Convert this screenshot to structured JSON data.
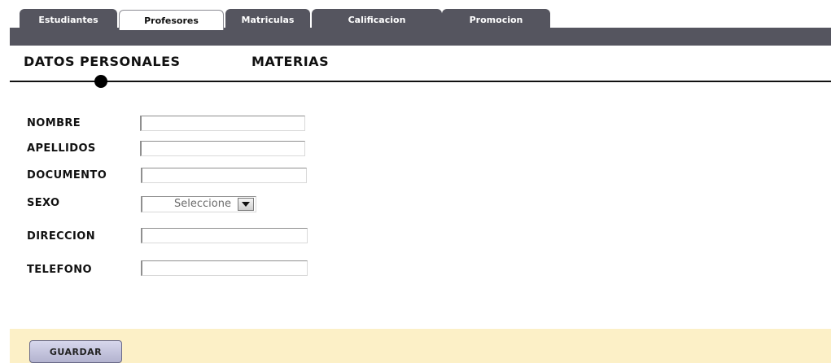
{
  "tabs": [
    {
      "label": "Estudiantes",
      "active": false
    },
    {
      "label": "Profesores",
      "active": true
    },
    {
      "label": "Matriculas",
      "active": false
    },
    {
      "label": "Calificacion",
      "active": false
    },
    {
      "label": "Promocion",
      "active": false
    }
  ],
  "subtabs": {
    "personal": "DATOS PERSONALES",
    "materias": "MATERIAS",
    "selected": "DATOS PERSONALES"
  },
  "form": {
    "nombre": {
      "label": "NOMBRE",
      "value": ""
    },
    "apellidos": {
      "label": "APELLIDOS",
      "value": ""
    },
    "documento": {
      "label": "DOCUMENTO",
      "value": ""
    },
    "sexo": {
      "label": "SEXO",
      "selected": "Seleccione"
    },
    "direccion": {
      "label": "DIRECCION",
      "value": ""
    },
    "telefono": {
      "label": "TELEFONO",
      "value": ""
    }
  },
  "footer": {
    "save_label": "GUARDAR"
  },
  "colors": {
    "tab_bar": "#55555f",
    "footer_bg": "#fcf0c7",
    "button_bg": "#c4c4dd"
  }
}
